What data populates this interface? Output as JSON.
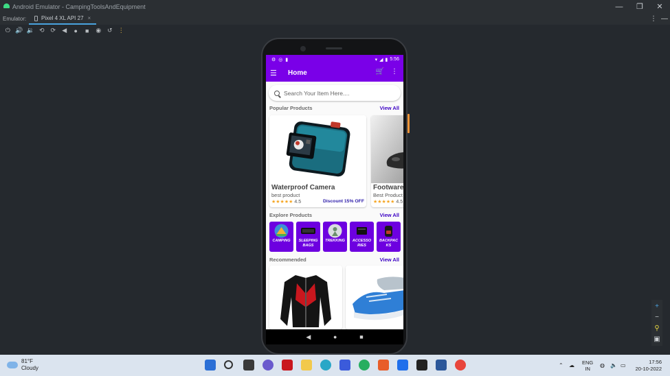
{
  "window": {
    "title": "Android Emulator - CampingToolsAndEquipment"
  },
  "tabs": {
    "label": "Emulator:",
    "active_tab": "Pixel 4 XL API 27"
  },
  "device": {
    "status_time": "5:56",
    "appbar_title": "Home",
    "search_placeholder": "Search Your Item Here....",
    "popular": {
      "title": "Popular Products",
      "view_all": "View All",
      "items": [
        {
          "name": "Waterproof Camera",
          "sub": "best product",
          "stars": "★★★★★",
          "rating": "4.5",
          "discount": "Discount 15% OFF"
        },
        {
          "name": "Footware",
          "sub": "Best Product",
          "stars": "★★★★★",
          "rating": "4.5"
        }
      ]
    },
    "explore": {
      "title": "Explore Products",
      "view_all": "View All",
      "items": [
        {
          "line1": "CAMPING",
          "line2": ""
        },
        {
          "line1": "SLEEPING",
          "line2": "BAGS"
        },
        {
          "line1": "TREKKING",
          "line2": ""
        },
        {
          "line1": "ACCESSO",
          "line2": "RIES"
        },
        {
          "line1": "BACKPAC",
          "line2": "KS"
        }
      ]
    },
    "recommended": {
      "title": "Recommended",
      "view_all": "View All"
    }
  },
  "taskbar": {
    "weather_temp": "81°F",
    "weather_desc": "Cloudy",
    "lang1": "ENG",
    "lang2": "IN",
    "time": "17:56",
    "date": "20-10-2022"
  },
  "colors": {
    "accent": "#7a00e8",
    "tile": "#6d00e0",
    "link": "#3b00c4",
    "star": "#f5a623"
  }
}
